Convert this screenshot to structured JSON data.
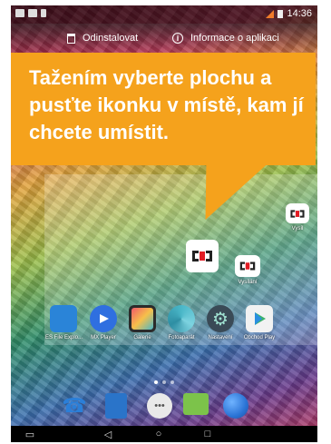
{
  "status_bar": {
    "time": "14:36"
  },
  "drop_bar": {
    "uninstall_label": "Odinstalovat",
    "app_info_label": "Informace o aplikaci"
  },
  "callout": {
    "text": "Tažením vyberte plochu a pusťte ikonku v místě, kam jí chcete umístit.",
    "color": "#f5a21c"
  },
  "home": {
    "ct_widget_label": "Vysílání",
    "ct_small_label": "Vysílání",
    "apps": [
      {
        "label": "ES File Explo...",
        "icon": "folder-icon",
        "color": "#2a84d8"
      },
      {
        "label": "MX Player",
        "icon": "play-icon",
        "color": "#2f6fe0"
      },
      {
        "label": "Galerie",
        "icon": "gallery-icon",
        "color": "#2b2b2b"
      },
      {
        "label": "Fotoaparát",
        "icon": "camera-icon",
        "color": "#4ab7c8"
      },
      {
        "label": "Nastavení",
        "icon": "gear-icon",
        "color": "#3a4a56"
      },
      {
        "label": "Obchod Play",
        "icon": "play-store-icon",
        "color": "#f2f2f2"
      }
    ],
    "right_page_label": "Vysíl"
  },
  "dock": [
    {
      "name": "phone",
      "icon": "phone-icon",
      "color": "#2b7fd8"
    },
    {
      "name": "contacts",
      "icon": "contacts-icon",
      "color": "#2a74c9"
    },
    {
      "name": "apps-drawer",
      "icon": "apps-grid-icon",
      "color": "#e9e9e9"
    },
    {
      "name": "messaging",
      "icon": "message-icon",
      "color": "#7cc34a"
    },
    {
      "name": "browser",
      "icon": "globe-icon",
      "color": "#2b74d6"
    }
  ],
  "nav": {
    "back": "◁",
    "home": "○",
    "recents": "□"
  }
}
